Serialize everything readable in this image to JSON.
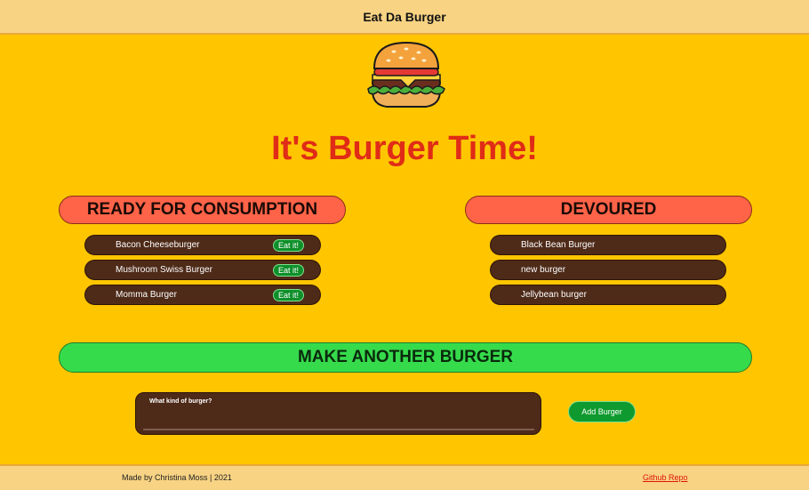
{
  "navbar": {
    "brand": "Eat Da Burger"
  },
  "logo": {
    "icon": "burger-icon"
  },
  "page_title": "It's Burger Time!",
  "ready": {
    "header": "READY FOR CONSUMPTION",
    "button_label": "Eat it!",
    "items": [
      {
        "name": "Bacon Cheeseburger"
      },
      {
        "name": "Mushroom Swiss Burger"
      },
      {
        "name": "Momma Burger"
      }
    ]
  },
  "devoured": {
    "header": "DEVOURED",
    "items": [
      {
        "name": "Black Bean Burger"
      },
      {
        "name": "new burger"
      },
      {
        "name": "Jellybean burger"
      }
    ]
  },
  "make": {
    "header": "MAKE ANOTHER BURGER",
    "input_label": "What kind of burger?",
    "input_value": "",
    "button_label": "Add Burger"
  },
  "footer": {
    "credit": "Made by Christina Moss | 2021",
    "repo_link": "Github Repo"
  },
  "colors": {
    "background": "#FFC600",
    "navbar": "#F7D383",
    "title": "#E02C17",
    "column_header": "#FF6348",
    "make_header": "#36DB4C",
    "item": "#4E2A18",
    "button": "#0E8F2A",
    "link": "#E0150B"
  }
}
